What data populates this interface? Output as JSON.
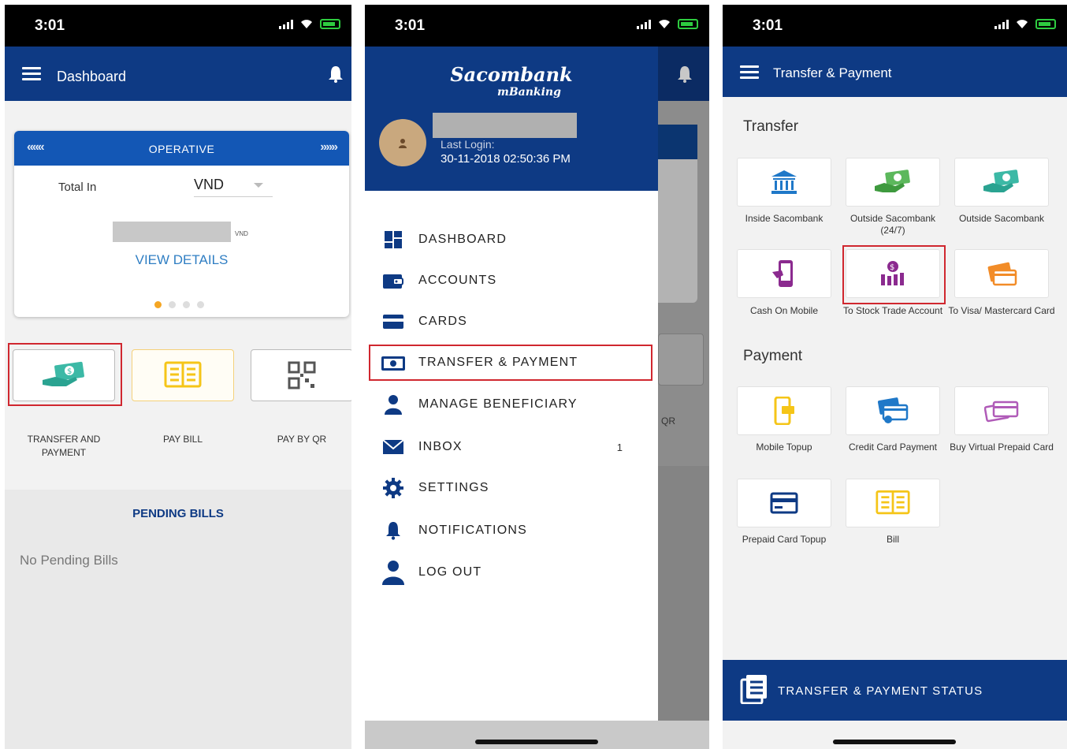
{
  "statusbar": {
    "time": "3:01"
  },
  "dashboard": {
    "title": "Dashboard",
    "card": {
      "status": "OPERATIVE",
      "left_arrows": "«««",
      "right_arrows": "»»»",
      "total_label": "Total In",
      "currency": "VND",
      "balance_unit": "VND",
      "view_details": "VIEW DETAILS",
      "active_dot": 0,
      "dot_count": 4
    },
    "quick_actions": [
      {
        "label": "TRANSFER AND PAYMENT",
        "icon": "cash-transfer-icon"
      },
      {
        "label": "PAY BILL",
        "icon": "bill-icon"
      },
      {
        "label": "PAY BY QR",
        "icon": "qr-code-icon"
      }
    ],
    "pending_title": "PENDING BILLS",
    "pending_empty": "No Pending Bills"
  },
  "drawer": {
    "brand": "Sacombank",
    "brand_sub": "mBanking",
    "last_login_label": "Last Login:",
    "last_login_value": "30-11-2018 02:50:36 PM",
    "items": [
      {
        "label": "DASHBOARD",
        "icon": "dashboard-icon"
      },
      {
        "label": "ACCOUNTS",
        "icon": "wallet-icon"
      },
      {
        "label": "CARDS",
        "icon": "card-icon"
      },
      {
        "label": "TRANSFER & PAYMENT",
        "icon": "cash-transfer-icon"
      },
      {
        "label": "MANAGE BENEFICIARY",
        "icon": "person-icon"
      },
      {
        "label": "INBOX",
        "icon": "envelope-icon",
        "badge": "1"
      },
      {
        "label": "SETTINGS",
        "icon": "gear-icon"
      },
      {
        "label": "NOTIFICATIONS",
        "icon": "bell-icon"
      },
      {
        "label": "LOG OUT",
        "icon": "user-logout-icon"
      }
    ],
    "behind_label": "QR"
  },
  "transfer_payment": {
    "title": "Transfer & Payment",
    "transfer_heading": "Transfer",
    "payment_heading": "Payment",
    "transfer_tiles": [
      {
        "label": "Inside Sacombank",
        "icon": "bank-icon"
      },
      {
        "label": "Outside Sacombank (24/7)",
        "icon": "cash-hand-icon"
      },
      {
        "label": "Outside Sacombank",
        "icon": "cash-hand-icon"
      },
      {
        "label": "Cash On Mobile",
        "icon": "mobile-cash-icon"
      },
      {
        "label": "To Stock Trade Account",
        "icon": "stock-icon"
      },
      {
        "label": "To Visa/ Mastercard Card",
        "icon": "wallet-card-icon"
      }
    ],
    "payment_tiles": [
      {
        "label": "Mobile Topup",
        "icon": "mobile-topup-icon"
      },
      {
        "label": "Credit Card Payment",
        "icon": "credit-card-pay-icon"
      },
      {
        "label": "Buy Virtual Prepaid Card",
        "icon": "virtual-card-icon"
      },
      {
        "label": "Prepaid Card Topup",
        "icon": "prepaid-card-icon"
      },
      {
        "label": "Bill",
        "icon": "bill-icon"
      }
    ],
    "status_label": "TRANSFER & PAYMENT STATUS"
  },
  "colors": {
    "brand_navy": "#0e3a84",
    "card_header": "#1357b5",
    "accent_green": "#3cb9a6",
    "highlight_red": "#d0272f",
    "bill_yellow": "#f5c518",
    "icon_purple": "#8b2a8f",
    "icon_orange": "#f28c28",
    "icon_blue": "#1f78c8"
  }
}
